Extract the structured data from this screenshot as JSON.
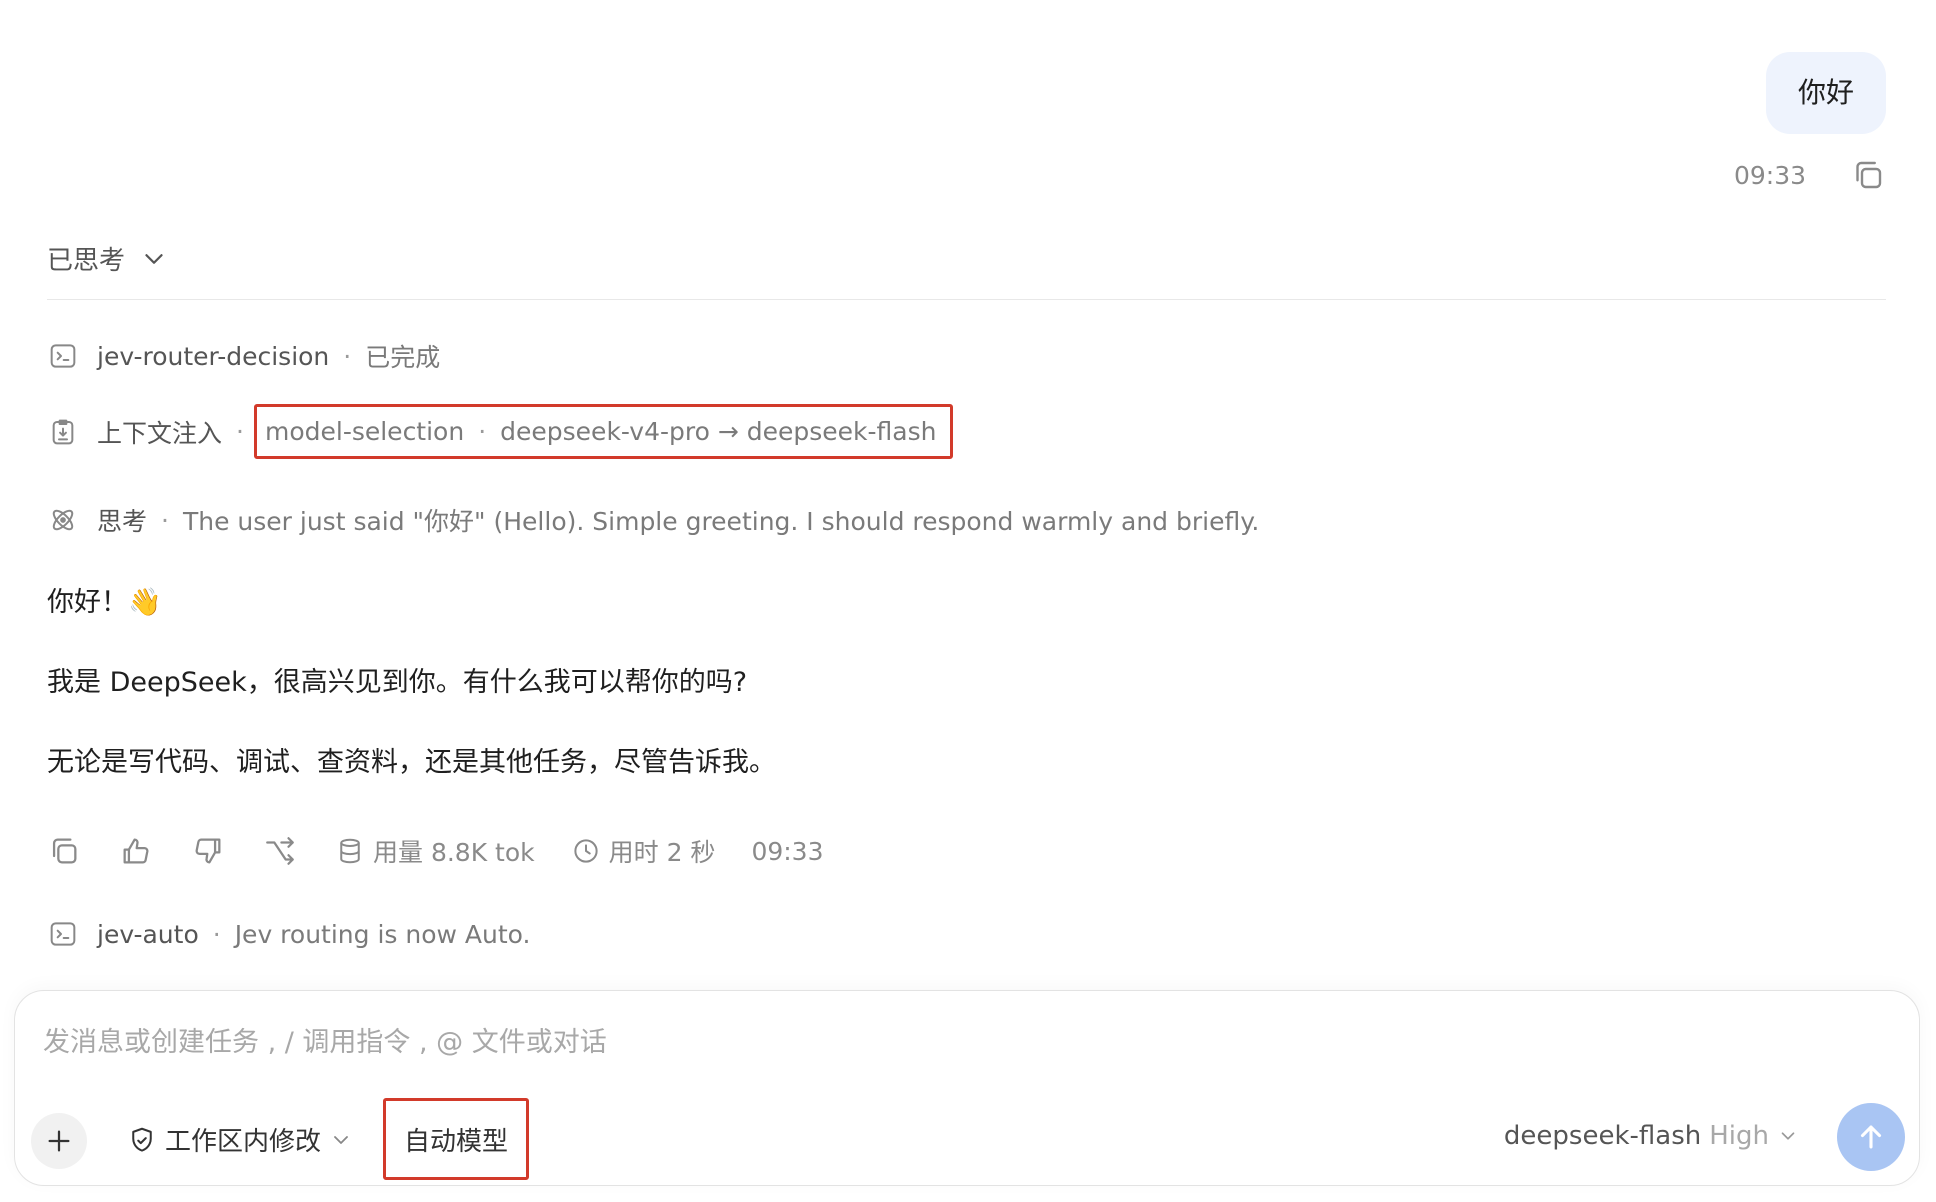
{
  "user_message": {
    "text": "你好",
    "time": "09:33"
  },
  "thought_toggle": {
    "label": "已思考"
  },
  "process": {
    "router": {
      "name": "jev-router-decision",
      "status": "已完成"
    },
    "context": {
      "name": "上下文注入",
      "detail_key": "model-selection",
      "detail_value": "deepseek-v4-pro → deepseek-flash"
    },
    "thinking": {
      "name": "思考",
      "text": "The user just said \"你好\" (Hello). Simple greeting. I should respond warmly and briefly."
    }
  },
  "reply": {
    "lines": [
      "你好！👋",
      "我是 DeepSeek，很高兴见到你。有什么我可以帮你的吗?",
      "无论是写代码、调试、查资料，还是其他任务，尽管告诉我。"
    ]
  },
  "reply_meta": {
    "usage": "用量 8.8K tok",
    "duration": "用时 2 秒",
    "time": "09:33"
  },
  "auto_notice": {
    "name": "jev-auto",
    "text": "Jev routing is now Auto."
  },
  "composer": {
    "placeholder": "发消息或创建任务 , / 调用指令 , @ 文件或对话",
    "mode_label": "工作区内修改",
    "auto_model_label": "自动模型",
    "model_name": "deepseek-flash",
    "reasoning_level": "High"
  },
  "colors": {
    "accent_send": "#a9c5f3",
    "highlight_border": "#d23a2a",
    "user_bubble": "#eef3fd"
  }
}
